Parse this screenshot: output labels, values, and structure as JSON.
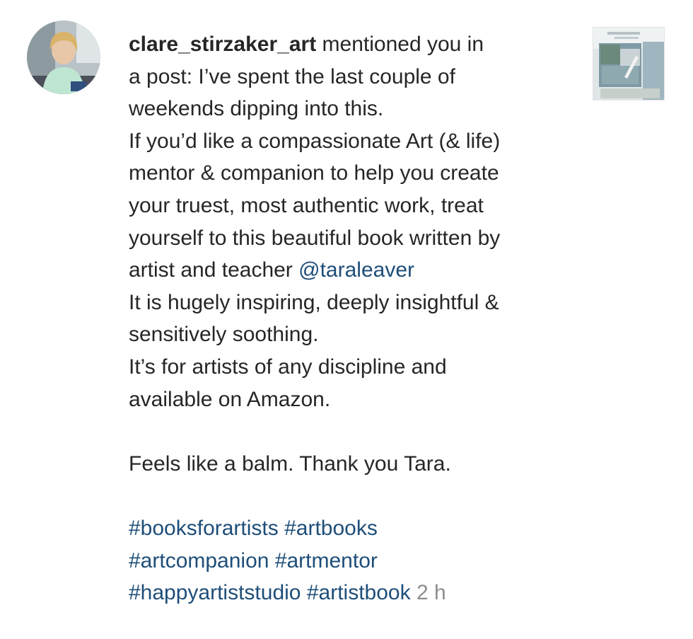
{
  "notification": {
    "username": "clare_stirzaker_art",
    "lines": {
      "l1": " mentioned you in",
      "l2": "a post: I’ve spent the last couple of",
      "l3": "weekends dipping into this.",
      "l4": "If you’d like a compassionate Art (& life)",
      "l5": "mentor & companion to help you create",
      "l6": "your truest, most authentic work, treat",
      "l7": "yourself to this beautiful book written by",
      "l8": "artist and teacher ",
      "l9": "It is hugely inspiring, deeply insightful &",
      "l10": "sensitively soothing.",
      "l11": "It’s for artists of any discipline and",
      "l12": "available on Amazon.",
      "l14": "Feels like a balm. Thank you Tara."
    },
    "mention": "@taraleaver",
    "hashtags": [
      "#booksforartists",
      "#artbooks",
      "#artcompanion",
      "#artmentor",
      "#happyartiststudio",
      "#artistbook"
    ],
    "timestamp": "2 h",
    "colors": {
      "text": "#262626",
      "link": "#1e4e79",
      "muted": "#8e8e8e"
    },
    "icons": {
      "avatar": "profile-photo",
      "post": "post-thumbnail"
    }
  }
}
